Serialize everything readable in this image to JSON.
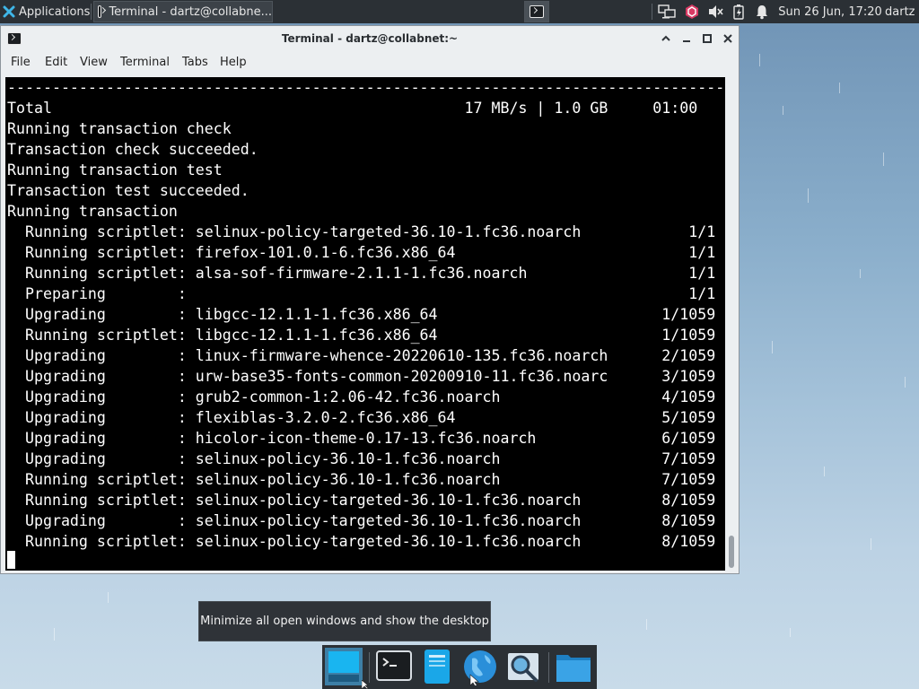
{
  "top_panel": {
    "applications_label": "Applications",
    "task_label": "Terminal - dartz@collabne...",
    "clock": "Sun 26 Jun, 17:20",
    "user": "dartz",
    "tray_icons": [
      "network-icon",
      "package-updater-icon",
      "volume-muted-icon",
      "battery-icon",
      "notifications-bell-icon"
    ]
  },
  "window": {
    "title": "Terminal - dartz@collabnet:~",
    "controls": [
      "maximize-up",
      "minimize",
      "restore",
      "close"
    ]
  },
  "menubar": [
    "File",
    "Edit",
    "View",
    "Terminal",
    "Tabs",
    "Help"
  ],
  "terminal": {
    "lines": [
      "--------------------------------------------------------------------------------",
      "Total                                              17 MB/s | 1.0 GB     01:00",
      "Running transaction check",
      "Transaction check succeeded.",
      "Running transaction test",
      "Transaction test succeeded.",
      "Running transaction",
      "  Running scriptlet: selinux-policy-targeted-36.10-1.fc36.noarch            1/1",
      "  Running scriptlet: firefox-101.0.1-6.fc36.x86_64                          1/1",
      "  Running scriptlet: alsa-sof-firmware-2.1.1-1.fc36.noarch                  1/1",
      "  Preparing        :                                                        1/1",
      "  Upgrading        : libgcc-12.1.1-1.fc36.x86_64                         1/1059",
      "  Running scriptlet: libgcc-12.1.1-1.fc36.x86_64                         1/1059",
      "  Upgrading        : linux-firmware-whence-20220610-135.fc36.noarch      2/1059",
      "  Upgrading        : urw-base35-fonts-common-20200910-11.fc36.noarc      3/1059",
      "  Upgrading        : grub2-common-1:2.06-42.fc36.noarch                  4/1059",
      "  Upgrading        : flexiblas-3.2.0-2.fc36.x86_64                       5/1059",
      "  Upgrading        : hicolor-icon-theme-0.17-13.fc36.noarch              6/1059",
      "  Upgrading        : selinux-policy-36.10-1.fc36.noarch                  7/1059",
      "  Running scriptlet: selinux-policy-36.10-1.fc36.noarch                  7/1059",
      "  Running scriptlet: selinux-policy-targeted-36.10-1.fc36.noarch         8/1059",
      "  Upgrading        : selinux-policy-targeted-36.10-1.fc36.noarch         8/1059",
      "  Running scriptlet: selinux-policy-targeted-36.10-1.fc36.noarch         8/1059"
    ]
  },
  "tooltip": "Minimize all open windows and show the desktop",
  "dock": {
    "items": [
      "show-desktop",
      "terminal",
      "mail-or-notes",
      "web-browser",
      "app-finder",
      "file-manager"
    ]
  }
}
